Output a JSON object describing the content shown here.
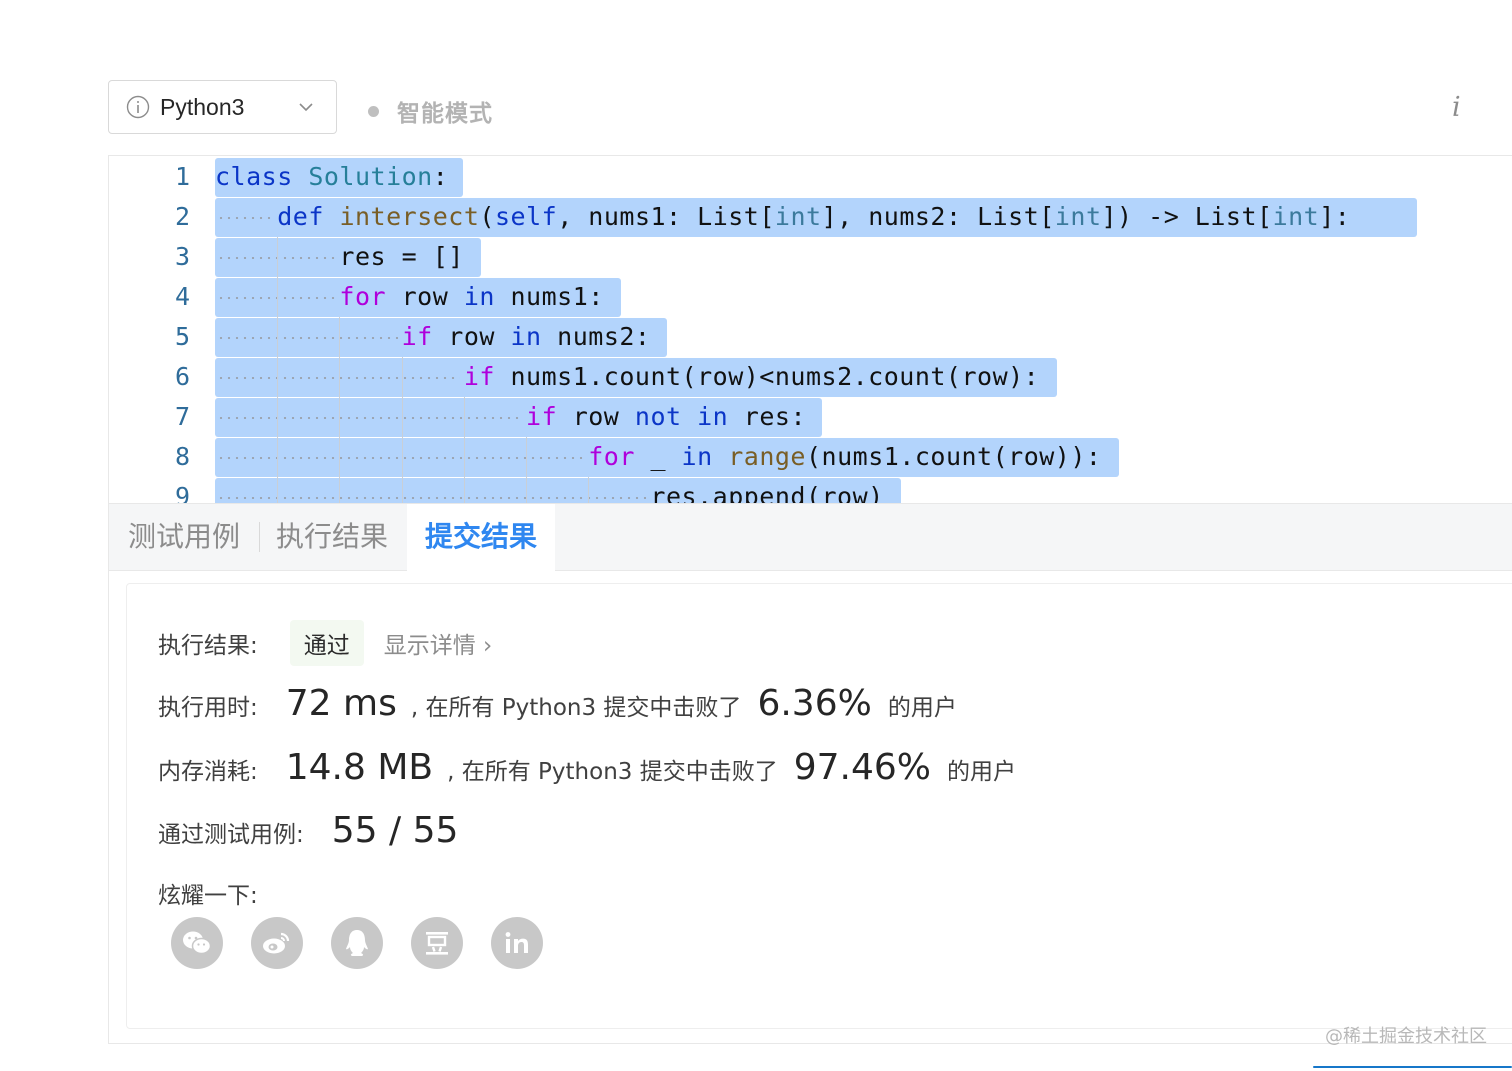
{
  "toolbar": {
    "language": "Python3",
    "language_icon": "info-circle-icon",
    "mode_label": "智能模式",
    "info_label": "i"
  },
  "editor": {
    "line_numbers": [
      "1",
      "2",
      "3",
      "4",
      "5",
      "6",
      "7",
      "8",
      "9"
    ]
  },
  "tabs": [
    {
      "label": "测试用例",
      "active": false
    },
    {
      "label": "执行结果",
      "active": false
    },
    {
      "label": "提交结果",
      "active": true
    }
  ],
  "result": {
    "status_label": "执行结果:",
    "status_value": "通过",
    "details_link": "显示详情 ›",
    "runtime_label": "执行用时:",
    "runtime_value": "72 ms",
    "runtime_text": ", 在所有 Python3 提交中击败了",
    "runtime_percent": "6.36%",
    "runtime_suffix": "的用户",
    "memory_label": "内存消耗:",
    "memory_value": "14.8 MB",
    "memory_text": ", 在所有 Python3 提交中击败了",
    "memory_percent": "97.46%",
    "memory_suffix": "的用户",
    "tests_label": "通过测试用例:",
    "tests_value": "55 / 55",
    "share_label": "炫耀一下:",
    "share_icons": [
      "wechat-icon",
      "weibo-icon",
      "qq-icon",
      "douban-icon",
      "linkedin-icon"
    ]
  },
  "watermark": "@稀土掘金技术社区",
  "colors": {
    "accent": "#2f87f0",
    "selection": "#b3d4fc",
    "keyword": "#0b35c7",
    "control": "#af00db"
  }
}
